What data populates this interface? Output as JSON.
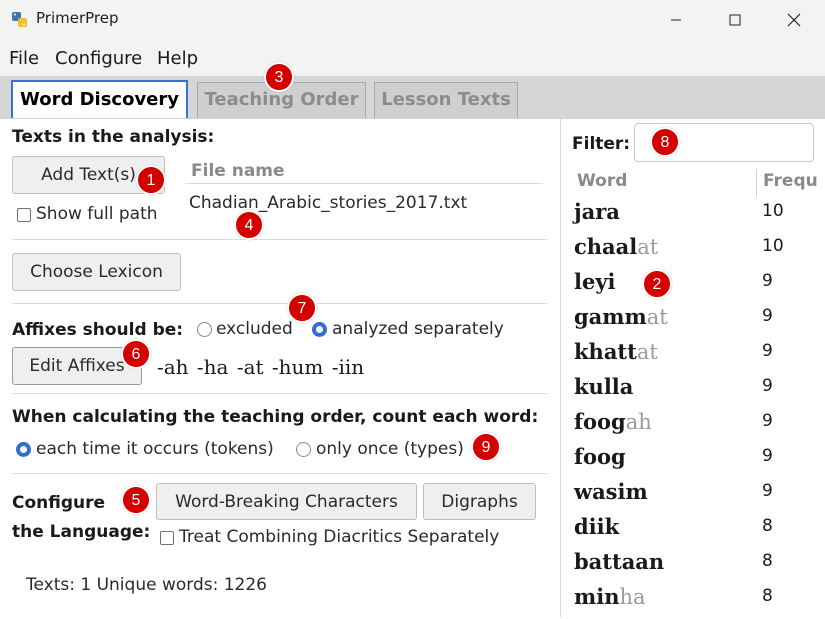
{
  "window": {
    "title": "PrimerPrep"
  },
  "menu": {
    "items": [
      "File",
      "Configure",
      "Help"
    ]
  },
  "tabs": [
    {
      "label": "Word Discovery",
      "active": true
    },
    {
      "label": "Teaching Order",
      "active": false
    },
    {
      "label": "Lesson Texts",
      "active": false
    }
  ],
  "texts_section": {
    "heading": "Texts in the analysis:",
    "add_button": "Add Text(s)",
    "show_full_path": "Show full path",
    "file_column_header": "File name",
    "files": [
      "Chadian_Arabic_stories_2017.txt"
    ]
  },
  "lexicon": {
    "button": "Choose Lexicon"
  },
  "affixes": {
    "label": "Affixes should be:",
    "options": [
      "excluded",
      "analyzed separately"
    ],
    "selected": "analyzed separately",
    "edit_button": "Edit Affixes",
    "list": "-ah -ha -at -hum -iin"
  },
  "counting": {
    "heading": "When calculating the teaching order, count each word:",
    "options": [
      "each time it occurs (tokens)",
      "only once (types)"
    ],
    "selected": "each time it occurs (tokens)"
  },
  "language": {
    "label_line1": "Configure",
    "label_line2": "the Language:",
    "word_breaking_button": "Word-Breaking Characters",
    "digraphs_button": "Digraphs",
    "combining_checkbox": "Treat Combining Diacritics Separately"
  },
  "status": {
    "text": "Texts: 1  Unique words: 1226"
  },
  "filter": {
    "label": "Filter:",
    "value": ""
  },
  "word_table": {
    "columns": [
      "Word",
      "Frequ"
    ],
    "rows": [
      {
        "stem": "jara",
        "suffix": "",
        "freq": "10"
      },
      {
        "stem": "chaal",
        "suffix": "at",
        "freq": "10"
      },
      {
        "stem": "leyi",
        "suffix": "",
        "freq": "9"
      },
      {
        "stem": "gamm",
        "suffix": "at",
        "freq": "9"
      },
      {
        "stem": "khatt",
        "suffix": "at",
        "freq": "9"
      },
      {
        "stem": "kulla",
        "suffix": "",
        "freq": "9"
      },
      {
        "stem": "foog",
        "suffix": "ah",
        "freq": "9"
      },
      {
        "stem": "foog",
        "suffix": "",
        "freq": "9"
      },
      {
        "stem": "wasim",
        "suffix": "",
        "freq": "9"
      },
      {
        "stem": "diik",
        "suffix": "",
        "freq": "8"
      },
      {
        "stem": "battaan",
        "suffix": "",
        "freq": "8"
      },
      {
        "stem": "min",
        "suffix": "ha",
        "freq": "8"
      }
    ]
  },
  "badges": [
    "1",
    "2",
    "3",
    "4",
    "5",
    "6",
    "7",
    "8",
    "9"
  ],
  "colors": {
    "accent": "#2f6fd6",
    "badge": "#d40000",
    "suffix": "#9a9a9a"
  }
}
